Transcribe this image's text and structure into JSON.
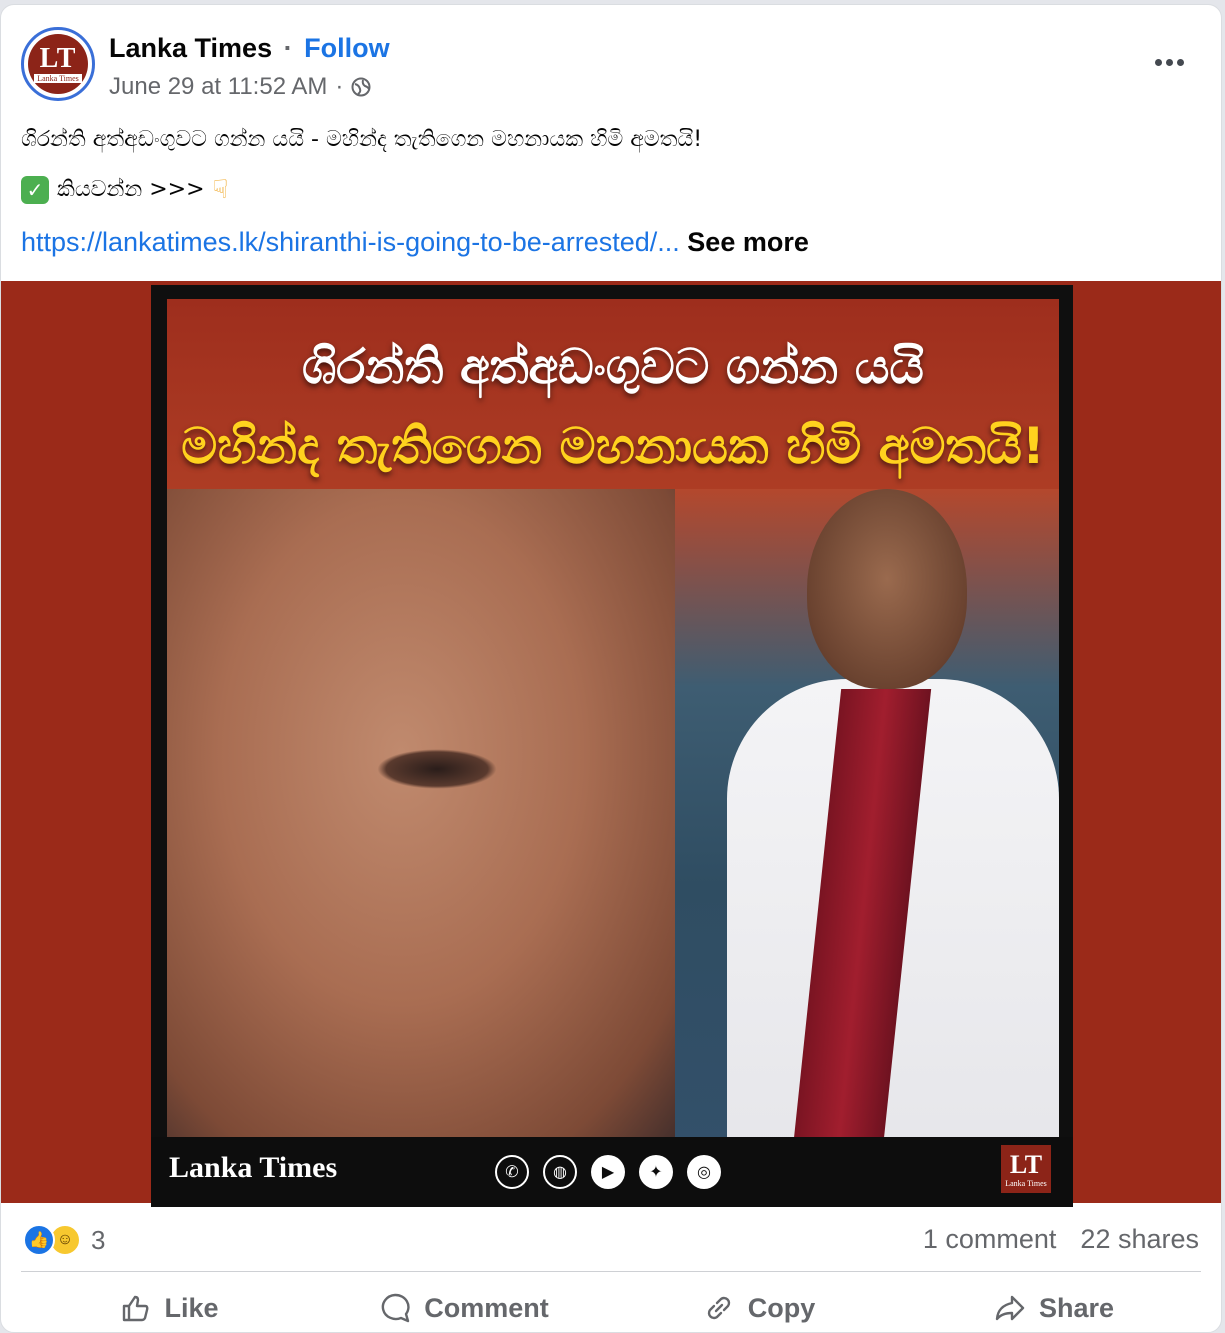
{
  "post": {
    "page_name": "Lanka Times",
    "separator": "·",
    "follow_label": "Follow",
    "timestamp": "June 29 at 11:52 AM",
    "meta_separator": "·",
    "audience_icon": "globe-icon",
    "avatar": {
      "letters": "LT",
      "sub": "Lanka Times"
    },
    "text_line1": "ශිරන්ති අත්අඩංගුවට ගන්න යයි - මහින්ද තැතිගෙන මහනායක හිමි අමතයි!",
    "text_line2_icon": "check-mark-icon",
    "text_line2": "කියවන්න >>>",
    "text_line2_end_icon": "pointing-down-icon",
    "link": "https://lankatimes.lk/shiranthi-is-going-to-be-arrested/...",
    "see_more": "See more"
  },
  "media": {
    "headline_line1": "ශිරන්ති අත්අඩංගුවට ගන්න යයි",
    "headline_line2": "මහින්ද තැතිගෙන මහනායක හිමි අමතයි!",
    "footer_brand": "Lanka Times",
    "social_icons": [
      "whatsapp-icon",
      "globe-icon",
      "youtube-icon",
      "twitter-icon",
      "instagram-icon"
    ],
    "badge_letters": "LT",
    "badge_sub": "Lanka Times"
  },
  "stats": {
    "reaction_count": "3",
    "reaction_icons": [
      "like-reaction-icon",
      "haha-reaction-icon"
    ],
    "comments": "1 comment",
    "shares": "22 shares"
  },
  "actions": {
    "like": "Like",
    "comment": "Comment",
    "copy": "Copy",
    "share": "Share"
  },
  "colors": {
    "accent": "#1b74e4",
    "media_bg": "#9b2a19",
    "headline_yellow": "#ffd21e",
    "muted_text": "#65676b"
  }
}
